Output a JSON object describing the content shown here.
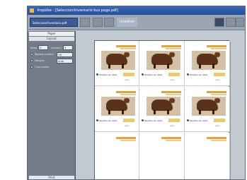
{
  "window": {
    "title": "Impolbe - [Seleccion/Inventario bus page.pdf]"
  },
  "toolbar": {
    "file_select": "Seleccion/Inventario.pdf",
    "label": "Imprimir",
    "icons": [
      "refresh-icon",
      "printer-icon",
      "zoom-icon",
      "grid-view-icon",
      "arrow-left-icon",
      "arrow-right-icon"
    ]
  },
  "sidebar": {
    "head": "Paper",
    "sub": "Layout",
    "rows_label": "Rows",
    "rows_value": "3",
    "cols_label": "Columns",
    "cols_value": "3",
    "opt1_label": "Repeat content",
    "opt1_value": "Off",
    "opt2_label": "Margins",
    "opt2_value": "Auto",
    "opt3_label": "Crop marks",
    "foot": "Print"
  },
  "cards": [
    {
      "caption": "Tarjetas de visita",
      "note": "Juan"
    },
    {
      "caption": "Tarjetas de visita",
      "note": "Juan"
    },
    {
      "caption": "Tarjetas de visita",
      "note": "Juan"
    },
    {
      "caption": "Tarjetas de visita",
      "note": "Juan"
    },
    {
      "caption": "Tarjetas de visita",
      "note": "Juan"
    },
    {
      "caption": "Tarjetas de visita",
      "note": "Juan"
    }
  ],
  "colors": {
    "accent": "#e7a436",
    "title_bar": "#2f5ca8",
    "sidebar": "#737d89"
  }
}
